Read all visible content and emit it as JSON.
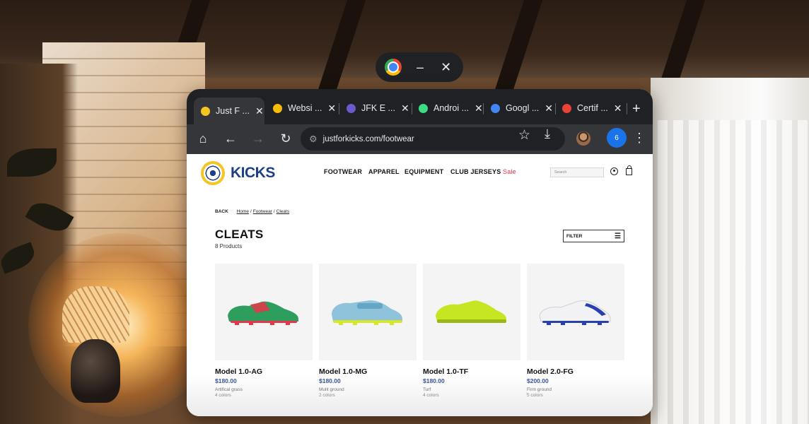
{
  "handle": {
    "app_icon": "chrome-icon",
    "minimize": "–",
    "close": "✕"
  },
  "tabs": [
    {
      "title": "Just F ...",
      "favicon_color": "#f3c623",
      "active": true
    },
    {
      "title": "Websi ...",
      "favicon_color": "#fbbc05",
      "active": false
    },
    {
      "title": "JFK E ...",
      "favicon_color": "#6a5acd",
      "active": false
    },
    {
      "title": "Androi ...",
      "favicon_color": "#3ddc84",
      "active": false
    },
    {
      "title": "Googl ...",
      "favicon_color": "#4285f4",
      "active": false
    },
    {
      "title": "Certif ...",
      "favicon_color": "#ea4335",
      "active": false
    }
  ],
  "newtab_label": "+",
  "toolbar": {
    "url": "justforkicks.com/footwear",
    "extension_badge": "6"
  },
  "site": {
    "logo_text": "KICKS",
    "nav": [
      "FOOTWEAR",
      "APPAREL",
      "EQUIPMENT",
      "CLUB JERSEYS"
    ],
    "sale": "Sale",
    "search_placeholder": "Search"
  },
  "breadcrumb": {
    "back": "BACK",
    "items": [
      "Home",
      "Footwear",
      "Cleats"
    ]
  },
  "listing": {
    "title": "CLEATS",
    "count": "8 Products",
    "filter_label": "FILTER"
  },
  "products": [
    {
      "name": "Model 1.0-AG",
      "price": "$180.00",
      "ground": "Artifical grass",
      "colors": "4 colors",
      "shoe_color": "#2e9e5e",
      "accent": "#e8354a"
    },
    {
      "name": "Model 1.0-MG",
      "price": "$180.00",
      "ground": "Mulit ground",
      "colors": "2 colors",
      "shoe_color": "#8fc3dc",
      "accent": "#d7e62a"
    },
    {
      "name": "Model 1.0-TF",
      "price": "$180.00",
      "ground": "Turf",
      "colors": "4 colors",
      "shoe_color": "#c6e623",
      "accent": "#9ab818"
    },
    {
      "name": "Model 2.0-FG",
      "price": "$200.00",
      "ground": "Firm ground",
      "colors": "5 colors",
      "shoe_color": "#f2f2f5",
      "accent": "#2a3fb0"
    }
  ]
}
